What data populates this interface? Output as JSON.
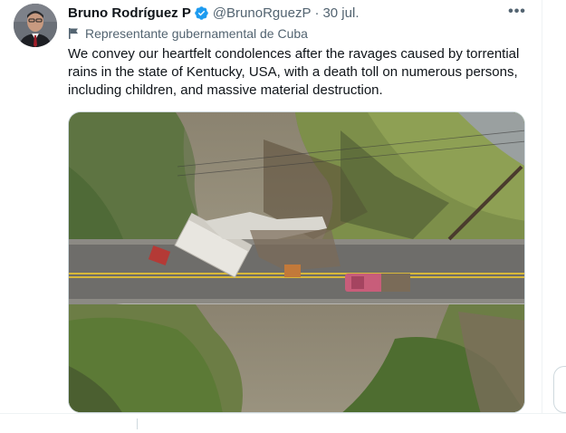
{
  "tweet": {
    "author_name": "Bruno Rodríguez P",
    "handle": "@BrunoRguezP",
    "separator": "·",
    "date": "30 jul.",
    "account_label": "Representante gubernamental de Cuba",
    "text": "We convey our heartfelt condolences after the ravages caused by torrential rains in the state of Kentucky, USA, with a death toll on numerous persons, including children, and massive material destruction.",
    "more_label": "•••"
  },
  "icons": {
    "verified": "verified-badge-icon",
    "label_flag": "flag-icon",
    "more": "more-options-icon"
  },
  "colors": {
    "verified_blue": "#1d9bf0",
    "secondary_text": "#536471",
    "primary_text": "#0f1419"
  }
}
